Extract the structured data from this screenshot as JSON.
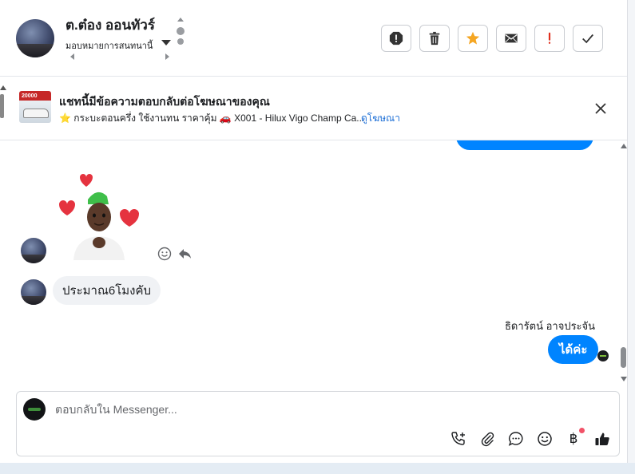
{
  "header": {
    "contact_name": "ต.ต๋อง ออนทัวร์",
    "assign_label": "มอบหมายการสนทนานี้",
    "actions": [
      {
        "name": "spam-alert-icon",
        "label": "!"
      },
      {
        "name": "trash-icon"
      },
      {
        "name": "star-icon"
      },
      {
        "name": "mail-icon"
      },
      {
        "name": "follow-up-icon",
        "label": "!"
      },
      {
        "name": "check-icon"
      }
    ]
  },
  "ad_banner": {
    "title": "แชทนี้มีข้อความตอบกลับต่อโฆษณาของคุณ",
    "thumb_price": "20000",
    "subtitle": "⭐ กระบะตอนครึ่ง ใช้งานทน ราคาคุ้ม 🚗 X001 - Hilux Vigo Champ Ca...",
    "view_ad_link": "ดูโฆษณา"
  },
  "messages": {
    "incoming_text": "ประมาณ6โมงคับ",
    "sender_name": "ธิดารัตน์ อาจประจัน",
    "outgoing_text": "ได้ค่ะ"
  },
  "composer": {
    "placeholder": "ตอบกลับใน Messenger...",
    "baht_symbol": "฿"
  },
  "colors": {
    "accent": "#0084ff",
    "star": "#f5a623",
    "alert_red": "#e0301e",
    "link": "#1d6fd6"
  }
}
